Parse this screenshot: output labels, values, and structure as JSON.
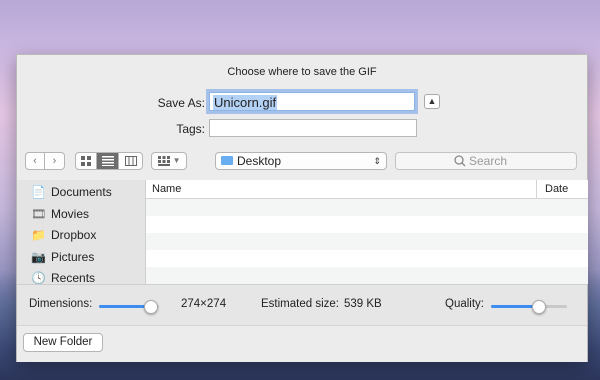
{
  "dialog": {
    "title": "Choose where to save the GIF",
    "save_as_label": "Save As:",
    "save_as_value": "Unicorn.gif",
    "tags_label": "Tags:",
    "tags_value": ""
  },
  "toolbar": {
    "back_icon": "chevron-left",
    "forward_icon": "chevron-right",
    "view_modes": [
      "icons",
      "list",
      "columns",
      "gallery"
    ],
    "active_view": "list",
    "location": "Desktop",
    "search_placeholder": "Search"
  },
  "sidebar": {
    "items": [
      {
        "label": "Documents",
        "icon": "documents-icon"
      },
      {
        "label": "Movies",
        "icon": "movies-icon"
      },
      {
        "label": "Dropbox",
        "icon": "folder-icon"
      },
      {
        "label": "Pictures",
        "icon": "camera-icon"
      },
      {
        "label": "Recents",
        "icon": "recents-icon"
      }
    ]
  },
  "filelist": {
    "columns": [
      "Name",
      "Date Mod"
    ]
  },
  "options": {
    "dimensions_label": "Dimensions:",
    "dimensions_value": "274×274",
    "dimensions_level": 0.85,
    "estimated_label": "Estimated size:",
    "estimated_value": "539 KB",
    "quality_label": "Quality:",
    "quality_level": 0.62
  },
  "footer": {
    "new_folder_label": "New Folder"
  },
  "colors": {
    "accent": "#3d8df0",
    "selection": "#b3d1f5"
  }
}
